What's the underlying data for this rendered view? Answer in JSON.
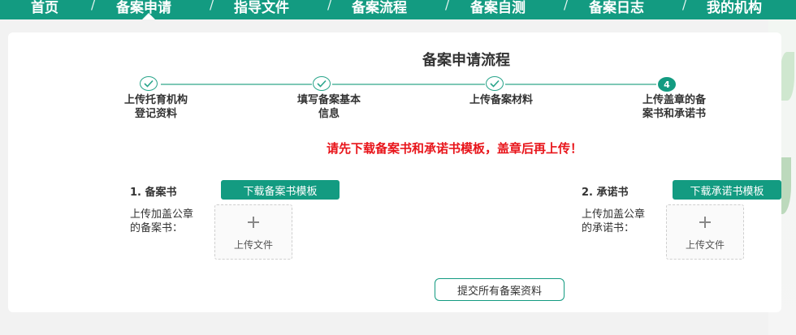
{
  "nav": {
    "items": [
      "首页",
      "备案申请",
      "指导文件",
      "备案流程",
      "备案自测",
      "备案日志",
      "我的机构"
    ],
    "separator": "/"
  },
  "page": {
    "title": "备案申请流程",
    "notice": "请先下载备案书和承诺书模板，盖章后再上传！"
  },
  "steps": [
    {
      "state": "done",
      "label": "上传托育机构\n登记资料"
    },
    {
      "state": "done",
      "label": "填写备案基本\n信息"
    },
    {
      "state": "done",
      "label": "上传备案材料"
    },
    {
      "state": "current",
      "number": "4",
      "label": "上传盖章的备\n案书和承诺书"
    }
  ],
  "sections": [
    {
      "title": "1. 备案书",
      "download_label": "下载备案书模板",
      "upload_label": "上传加盖公章\n的备案书：",
      "upload_text": "上传文件"
    },
    {
      "title": "2. 承诺书",
      "download_label": "下载承诺书模板",
      "upload_label": "上传加盖公章\n的承诺书：",
      "upload_text": "上传文件"
    }
  ],
  "submit_label": "提交所有备案资料",
  "colors": {
    "primary": "#139b81",
    "notice": "#e8141a",
    "step_line": "#7ec8b6"
  }
}
